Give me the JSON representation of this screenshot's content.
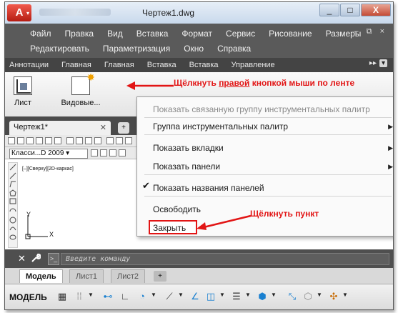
{
  "title_bar": {
    "app_letter": "A",
    "document_title": "Чертеж1.dwg",
    "controls": [
      "_",
      "□",
      "X"
    ]
  },
  "menu": {
    "row1": [
      "Файл",
      "Правка",
      "Вид",
      "Вставка",
      "Формат",
      "Сервис",
      "Рисование",
      "Размеры"
    ],
    "row2": [
      "Редактировать",
      "Параметризация",
      "Окно",
      "Справка"
    ],
    "window_controls": "– ⧉ ×"
  },
  "ribbon_tabs": [
    "Аннотации",
    "Главная",
    "Главная",
    "Вставка",
    "Вставка",
    "Управление"
  ],
  "ribbon_tab_controls": {
    "more": "▸▸",
    "dropdown": "▾"
  },
  "ribbon_buttons": {
    "sheet": "Лист",
    "views": "Видовые..."
  },
  "callout_top": {
    "prefix": "Щёлкнуть ",
    "underlined": "правой",
    "suffix": " кнопкой мыши по ленте"
  },
  "file_tab": {
    "name": "Чертеж1*",
    "close": "✕",
    "add": "+"
  },
  "toolbar": {
    "style_select": "Класси...D 2009 ▾"
  },
  "viewport_label": "[–][Сверху][2D-каркас]",
  "ucs": {
    "x": "X",
    "y": "Y"
  },
  "context_menu": {
    "items": [
      {
        "label": "Показать связанную группу инструментальных палитр",
        "disabled": true
      },
      {
        "label": "Группа инструментальных палитр",
        "submenu": true
      },
      {
        "label": "Показать вкладки",
        "submenu": true
      },
      {
        "label": "Показать панели",
        "submenu": true
      },
      {
        "label": "Показать названия панелей",
        "checked": true
      },
      {
        "label": "Освободить"
      },
      {
        "label": "Закрыть",
        "highlighted": true
      }
    ],
    "submenu_glyph": "▶",
    "check_glyph": "✔"
  },
  "callout_bottom": "Щёлкнуть пункт",
  "command_line": {
    "close": "✕",
    "wrench": "🔧",
    "prompt": ">_",
    "placeholder": "Введите команду"
  },
  "layout_tabs": [
    "Модель",
    "Лист1",
    "Лист2"
  ],
  "layout_add": "+",
  "status_bar": {
    "model": "МОДЕЛЬ",
    "icons": [
      "grid-icon",
      "snap-icon",
      "ortho-icon",
      "polar-icon",
      "osnap-icon",
      "otrack-icon",
      "lineweight-icon",
      "transparency-icon",
      "selection-icon",
      "annotation-icon",
      "workspace-icon",
      "isolate-icon"
    ]
  },
  "colors": {
    "accent_red": "#e21515",
    "ribbon_dark": "#444444",
    "menubar": "#5a5a5a"
  }
}
